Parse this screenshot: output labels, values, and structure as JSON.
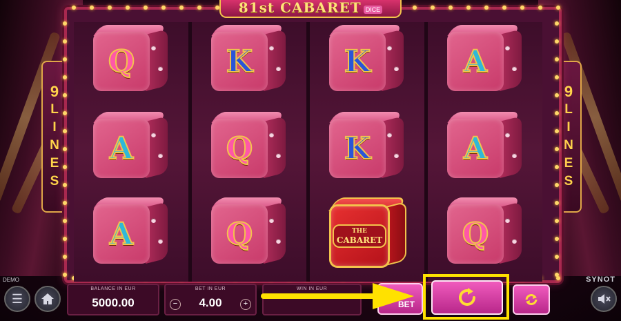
{
  "game": {
    "title": "81st CABARET",
    "title_tag": "DICE"
  },
  "lines_panel": {
    "count": "9",
    "word": [
      "L",
      "I",
      "N",
      "E",
      "S"
    ]
  },
  "reels": [
    [
      "Q",
      "A",
      "A"
    ],
    [
      "K",
      "Q",
      "Q"
    ],
    [
      "K",
      "K",
      "THE CABARET"
    ],
    [
      "A",
      "A",
      "Q"
    ]
  ],
  "cabaret_symbol": {
    "line1": "THE",
    "line2": "CABARET"
  },
  "bottom_bar": {
    "mode_label": "DEMO",
    "brand": "SYNOT",
    "balance": {
      "caption": "BALANCE IN EUR",
      "value": "5000.00"
    },
    "bet": {
      "caption": "BET IN EUR",
      "value": "4.00",
      "minus": "−",
      "plus": "+"
    },
    "win": {
      "caption": "WIN IN EUR",
      "value": ""
    },
    "bet_button_label": "BET"
  },
  "icons": {
    "menu": "menu-icon",
    "home": "home-icon",
    "spin": "spin-icon",
    "autoplay": "autoplay-icon",
    "sound": "sound-muted-icon"
  },
  "colors": {
    "accent_yellow": "#ffe100",
    "spin_pink": "#e24aa8",
    "frame": "#a8284f",
    "gold": "#f2c34c"
  }
}
